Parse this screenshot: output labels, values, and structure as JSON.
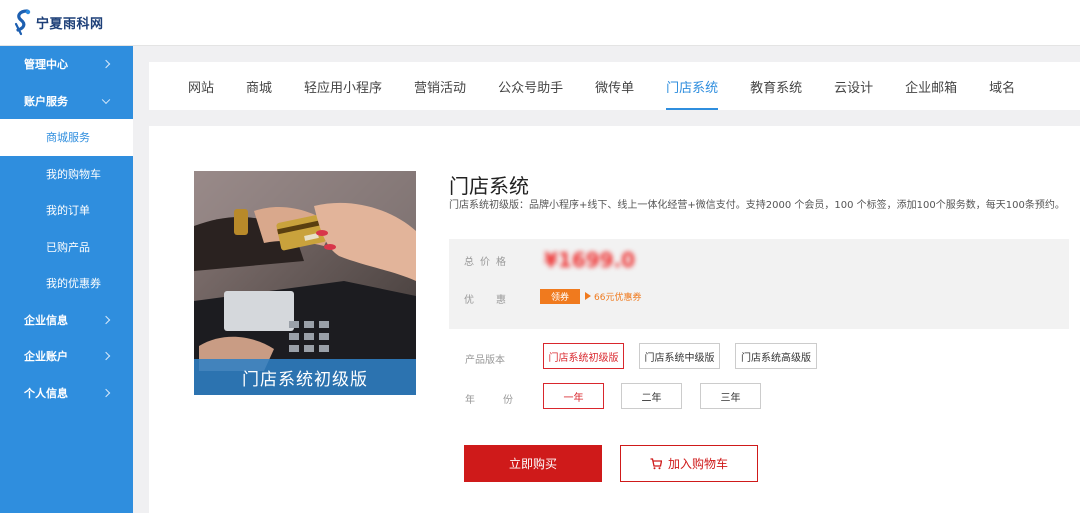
{
  "header": {
    "logo_text": "宁夏雨科网",
    "logo_icon": "brand-logo-icon"
  },
  "sidebar": {
    "items": [
      {
        "label": "管理中心"
      },
      {
        "label": "账户服务"
      },
      {
        "label": "商城服务"
      },
      {
        "label": "我的购物车"
      },
      {
        "label": "我的订单"
      },
      {
        "label": "已购产品"
      },
      {
        "label": "我的优惠券"
      },
      {
        "label": "企业信息"
      },
      {
        "label": "企业账户"
      },
      {
        "label": "个人信息"
      }
    ]
  },
  "tabs": [
    "网站",
    "商城",
    "轻应用小程序",
    "营销活动",
    "公众号助手",
    "微传单",
    "门店系统",
    "教育系统",
    "云设计",
    "企业邮箱",
    "域名"
  ],
  "product": {
    "image_caption": "门店系统初级版",
    "title": "门店系统",
    "description": "门店系统初级版：品牌小程序+线下、线上一体化经营+微信支付。支持2000 个会员，100 个标签，添加100个服务数，每天100条预约。",
    "price_label": "总价格",
    "price_value": "¥1699.0",
    "discount_label": "优惠",
    "coupon_button": "领券",
    "coupon_text": "66元优惠券",
    "version_label": "产品版本",
    "versions": [
      "门店系统初级版",
      "门店系统中级版",
      "门店系统高级版"
    ],
    "year_label": "年份",
    "years": [
      "一年",
      "二年",
      "三年"
    ],
    "buy_label": "立即购买",
    "cart_label": "加入购物车"
  },
  "colors": {
    "accent": "#2f8ede",
    "sidebar": "#2f8ede",
    "buy": "#cf1a1a",
    "coupon": "#f07a1e"
  }
}
